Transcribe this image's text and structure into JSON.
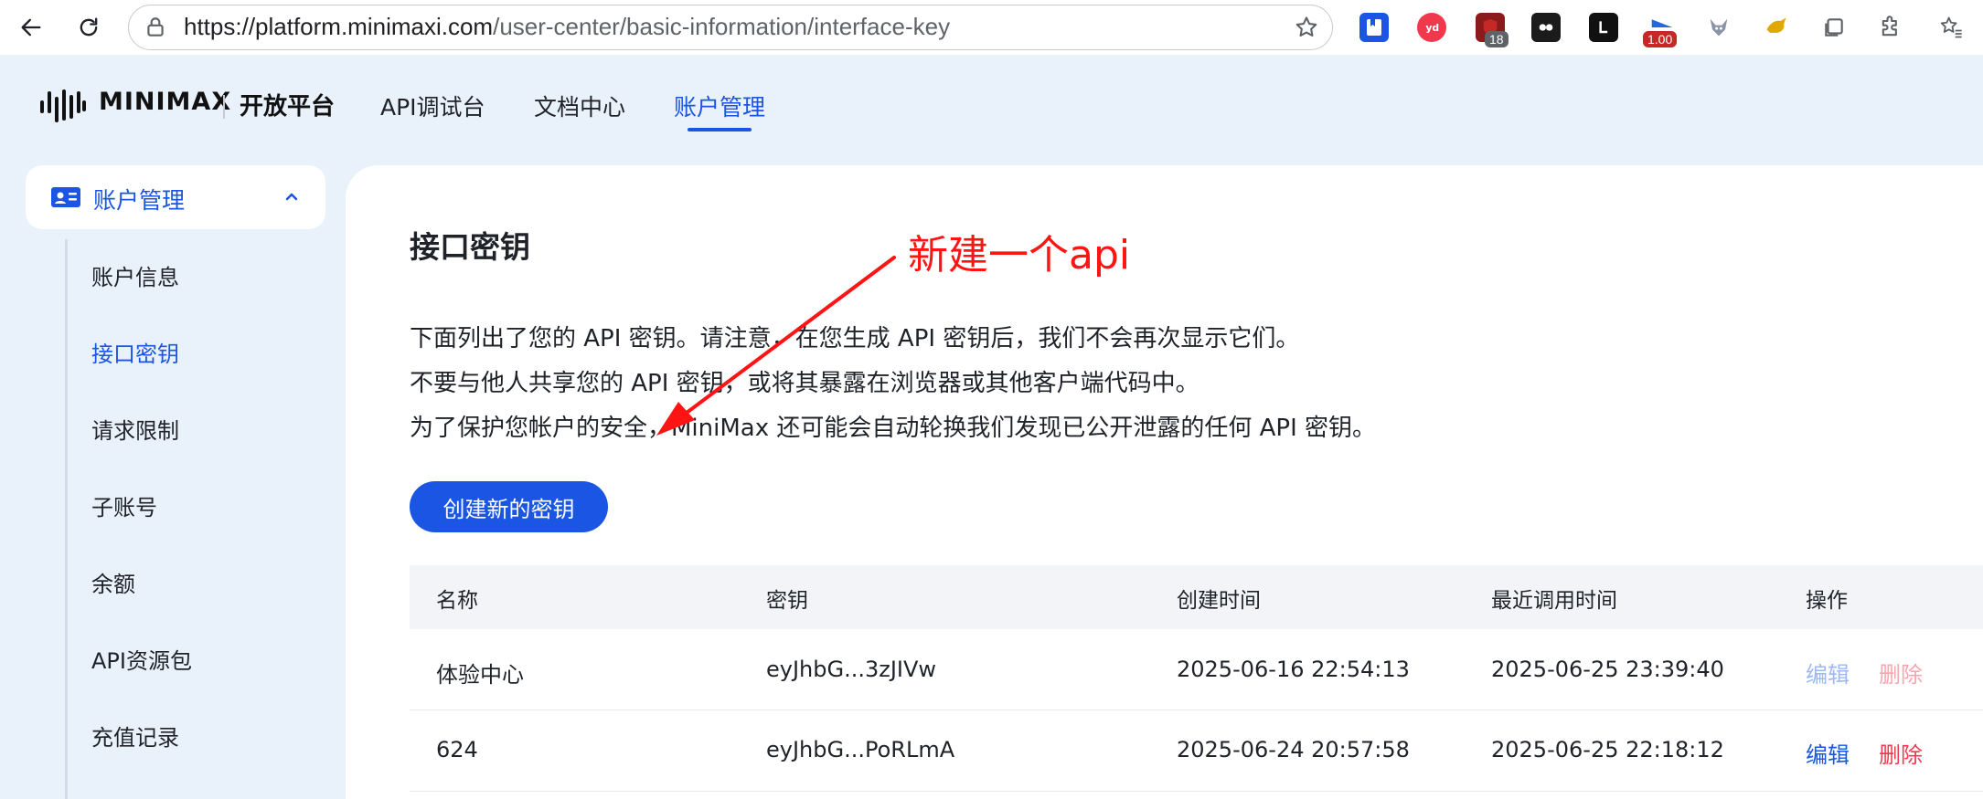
{
  "browser": {
    "url_host": "https://platform.minimaxi.com",
    "url_path": "/user-center/basic-information/interface-key",
    "extensions": [
      {
        "icon": "bookmark-manager-icon",
        "color": "#1a55e3"
      },
      {
        "icon": "youdao-icon",
        "color": "#f0394d"
      },
      {
        "icon": "ublock-icon",
        "color": "#8b1a1a",
        "badge": "18"
      },
      {
        "icon": "cat-mask-icon",
        "color": "#1b1b1b"
      },
      {
        "icon": "l-extension-icon",
        "color": "#111111"
      },
      {
        "icon": "speed-flag-icon",
        "color": "#1e6be0",
        "badge": "1.00"
      },
      {
        "icon": "fox-icon",
        "color": "#9aa6b5"
      },
      {
        "icon": "tampermonkey-icon",
        "color": "#e0a800"
      },
      {
        "icon": "tab-manager-icon",
        "color": "#5f6368"
      },
      {
        "icon": "extensions-puzzle-icon",
        "color": "#5f6368"
      },
      {
        "icon": "favorites-icon",
        "color": "#5f6368"
      }
    ]
  },
  "header": {
    "logo": "MINIMAX",
    "platform": "开放平台",
    "nav": [
      "API调试台",
      "文档中心",
      "账户管理"
    ],
    "active_nav": "账户管理"
  },
  "sidebar": {
    "parent": "账户管理",
    "items": [
      "账户信息",
      "接口密钥",
      "请求限制",
      "子账号",
      "余额",
      "API资源包",
      "充值记录"
    ],
    "active_item": "接口密钥"
  },
  "main": {
    "title": "接口密钥",
    "desc": [
      "下面列出了您的 API 密钥。请注意，在您生成 API 密钥后，我们不会再次显示它们。",
      "不要与他人共享您的 API 密钥，或将其暴露在浏览器或其他客户端代码中。",
      "为了保护您帐户的安全，MiniMax 还可能会自动轮换我们发现已公开泄露的任何 API 密钥。"
    ],
    "create_button": "创建新的密钥",
    "table": {
      "headers": [
        "名称",
        "密钥",
        "创建时间",
        "最近调用时间",
        "操作"
      ],
      "rows": [
        {
          "name": "体验中心",
          "key": "eyJhbG...3zJIVw",
          "created": "2025-06-16 22:54:13",
          "last_used": "2025-06-25 23:39:40",
          "edit": "编辑",
          "delete": "删除",
          "disabled": true
        },
        {
          "name": "624",
          "key": "eyJhbG...PoRLmA",
          "created": "2025-06-24 20:57:58",
          "last_used": "2025-06-25 22:18:12",
          "edit": "编辑",
          "delete": "删除",
          "disabled": false
        }
      ]
    }
  },
  "annotation": {
    "text": "新建一个api",
    "color": "#ff1414"
  },
  "colors": {
    "accent": "#1a55e3",
    "danger": "#f0394d",
    "page_bg": "#e9f1fb"
  }
}
